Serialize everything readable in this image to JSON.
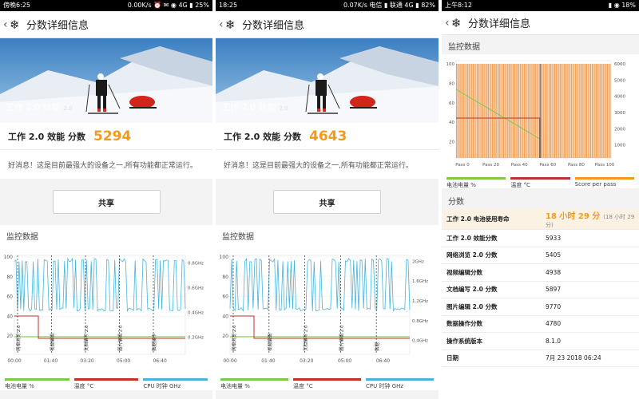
{
  "panels": [
    {
      "status": {
        "left": "傍晚6:25",
        "right": "0.00K/s ⏰ ✉ ◉ 4G ▮ 25%"
      },
      "title": "分数详细信息",
      "hero_caption": "工作 2.0 效能",
      "hero_version": "2.0",
      "score_label": "工作 2.0 效能 分数",
      "score_value": "5294",
      "message": "好消息！这是目前最强大的设备之一,所有功能都正常运行。",
      "share_label": "共享",
      "section_title": "监控数据",
      "monitor_chart": {
        "left_ticks": [
          "100",
          "80",
          "60",
          "40",
          "20"
        ],
        "right_ticks": [
          "0.8GHz",
          "0.6GHz",
          "0.4GHz",
          "0.2GHz"
        ],
        "x_ticks": [
          "00:00",
          "01:40",
          "03:20",
          "05:00",
          "06:40"
        ],
        "markers": [
          "网络浏览 2.0",
          "视频编辑",
          "文档编写 2.0",
          "图片编辑 2.0",
          "数据操作"
        ]
      },
      "legend": [
        "电池电量 %",
        "温度 °C",
        "CPU 时钟 GHz"
      ]
    },
    {
      "status": {
        "left": "18:25",
        "right": "0.07K/s 电信 ▮ 联通 4G ▮ 82%"
      },
      "title": "分数详细信息",
      "hero_caption": "工作 2.0 效能",
      "hero_version": "2.0",
      "score_label": "工作 2.0 效能 分数",
      "score_value": "4643",
      "message": "好消息！这是目前最强大的设备之一,所有功能都正常运行。",
      "share_label": "共享",
      "section_title": "监控数据",
      "monitor_chart": {
        "left_ticks": [
          "100",
          "80",
          "60",
          "40",
          "20"
        ],
        "right_ticks": [
          "2GHz",
          "1.6GHz",
          "1.2GHz",
          "0.8GHz",
          "0.4GHz"
        ],
        "x_ticks": [
          "00:00",
          "01:40",
          "03:20",
          "05:00",
          "06:40"
        ],
        "markers": [
          "网络浏览 2.0",
          "视频编辑",
          "文档编写 2.0",
          "图片编辑 2.0",
          "数据"
        ]
      },
      "legend": [
        "电池电量 %",
        "温度 °C",
        "CPU 时钟 GHz"
      ]
    },
    {
      "status": {
        "left": "上午8:12",
        "right": "▮ ◉ 18%"
      },
      "title": "分数详细信息",
      "section_title": "监控数据",
      "battery_chart": {
        "left_ticks": [
          "100",
          "80",
          "60",
          "40",
          "20"
        ],
        "right_ticks": [
          "6000",
          "5000",
          "4000",
          "3000",
          "2000",
          "1000"
        ],
        "x_ticks": [
          "Pass 0",
          "Pass 20",
          "Pass 40",
          "Pass 60",
          "Pass 80",
          "Pass 100"
        ]
      },
      "legend": [
        "电池电量 %",
        "温度 °C",
        "Score per pass"
      ],
      "scores_title": "分数",
      "scores": [
        {
          "label": "工作 2.0 电池使用寿命",
          "value": "18 小时 29 分",
          "extra": "(18 小时 29 分)"
        },
        {
          "label": "工作 2.0 效能分数",
          "value": "5933"
        },
        {
          "label": "网络浏览 2.0 分数",
          "value": "5405"
        },
        {
          "label": "视频编辑分数",
          "value": "4938"
        },
        {
          "label": "文档编写 2.0 分数",
          "value": "5897"
        },
        {
          "label": "图片编辑 2.0 分数",
          "value": "9770"
        },
        {
          "label": "数据操作分数",
          "value": "4780"
        },
        {
          "label": "操作系统版本",
          "value": "8.1.0"
        },
        {
          "label": "日期",
          "value": "7月 23 2018 06:24"
        }
      ]
    }
  ],
  "colors": {
    "accent": "#f39a1d",
    "battery": "#7dc94a",
    "temp": "#c0312b",
    "cpu": "#45b5dd",
    "score_bar": "#f0a15a"
  }
}
